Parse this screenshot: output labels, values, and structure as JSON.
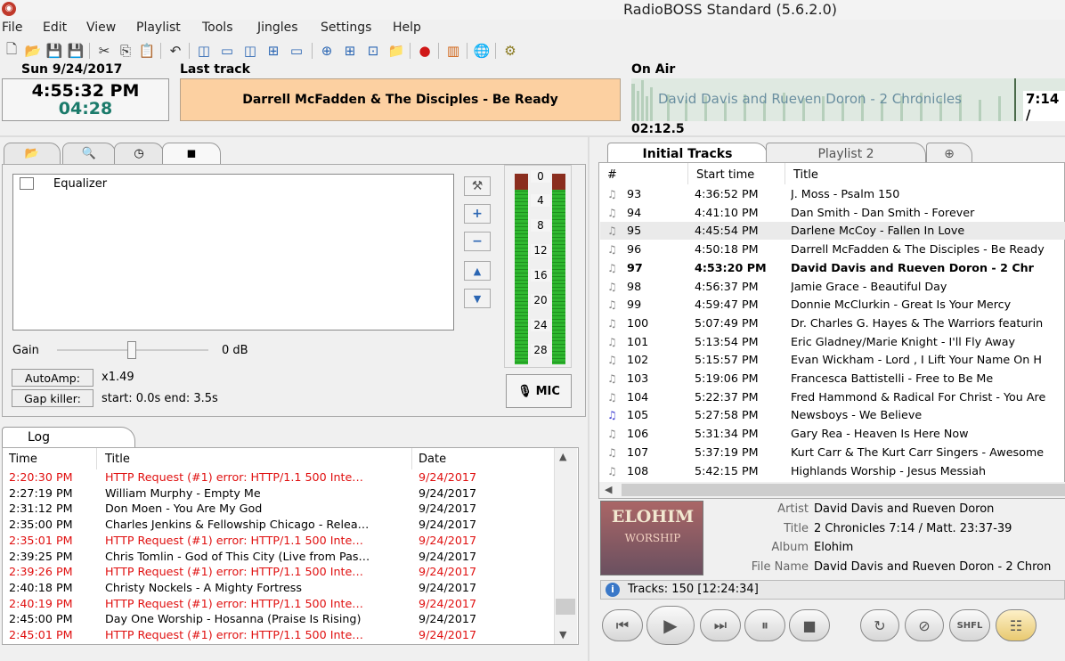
{
  "window": {
    "title": "RadioBOSS Standard (5.6.2.0)"
  },
  "menu": [
    "File",
    "Edit",
    "View",
    "Playlist",
    "Tools",
    "Jingles",
    "Settings",
    "Help"
  ],
  "header": {
    "date": "Sun 9/24/2017",
    "last_track_label": "Last track",
    "on_air_label": "On Air",
    "clock": "4:55:32 PM",
    "countdown": "04:28",
    "last_track": "Darrell McFadden & The Disciples - Be Ready",
    "on_air_title": "David Davis and Rueven Doron - 2 Chronicles",
    "on_air_time": "7:14 /",
    "elapsed": "02:12.5"
  },
  "effects": {
    "equalizer_label": "Equalizer",
    "equalizer_checked": false,
    "gain_label": "Gain",
    "gain_value": "0 dB",
    "autoamp_label": "AutoAmp:",
    "autoamp_value": "x1.49",
    "gapkiller_label": "Gap killer:",
    "gapkiller_value": "start: 0.0s end: 3.5s",
    "mic_label": "MIC",
    "vu_ticks": [
      "0",
      "4",
      "8",
      "12",
      "16",
      "20",
      "24",
      "28"
    ]
  },
  "log": {
    "tab": "Log",
    "columns": [
      "Time",
      "Title",
      "Date"
    ],
    "rows": [
      {
        "time": "2:20:30 PM",
        "title": "HTTP Request (#1) error: HTTP/1.1 500 Inte…",
        "date": "9/24/2017",
        "error": true
      },
      {
        "time": "2:27:19 PM",
        "title": "William Murphy - Empty Me",
        "date": "9/24/2017",
        "error": false
      },
      {
        "time": "2:31:12 PM",
        "title": "Don Moen - You Are My God",
        "date": "9/24/2017",
        "error": false
      },
      {
        "time": "2:35:00 PM",
        "title": "Charles Jenkins & Fellowship Chicago - Relea…",
        "date": "9/24/2017",
        "error": false
      },
      {
        "time": "2:35:01 PM",
        "title": "HTTP Request (#1) error: HTTP/1.1 500 Inte…",
        "date": "9/24/2017",
        "error": true
      },
      {
        "time": "2:39:25 PM",
        "title": "Chris Tomlin - God of This City (Live from Pas…",
        "date": "9/24/2017",
        "error": false
      },
      {
        "time": "2:39:26 PM",
        "title": "HTTP Request (#1) error: HTTP/1.1 500 Inte…",
        "date": "9/24/2017",
        "error": true
      },
      {
        "time": "2:40:18 PM",
        "title": "Christy Nockels - A Mighty Fortress",
        "date": "9/24/2017",
        "error": false
      },
      {
        "time": "2:40:19 PM",
        "title": "HTTP Request (#1) error: HTTP/1.1 500 Inte…",
        "date": "9/24/2017",
        "error": true
      },
      {
        "time": "2:45:00 PM",
        "title": "Day One Worship - Hosanna (Praise Is Rising)",
        "date": "9/24/2017",
        "error": false
      },
      {
        "time": "2:45:01 PM",
        "title": "HTTP Request (#1) error: HTTP/1.1 500 Inte…",
        "date": "9/24/2017",
        "error": true
      }
    ]
  },
  "playlist": {
    "tabs": [
      "Initial Tracks",
      "Playlist 2"
    ],
    "columns": [
      "#",
      "Start time",
      "Title"
    ],
    "rows": [
      {
        "n": "93",
        "start": "4:36:52 PM",
        "title": "J. Moss - Psalm 150"
      },
      {
        "n": "94",
        "start": "4:41:10 PM",
        "title": "Dan Smith - Dan Smith - Forever"
      },
      {
        "n": "95",
        "start": "4:45:54 PM",
        "title": "Darlene McCoy - Fallen In Love"
      },
      {
        "n": "96",
        "start": "4:50:18 PM",
        "title": "Darrell McFadden & The Disciples - Be Ready"
      },
      {
        "n": "97",
        "start": "4:53:20 PM",
        "title": "David Davis and Rueven Doron - 2 Chr"
      },
      {
        "n": "98",
        "start": "4:56:37 PM",
        "title": "Jamie Grace - Beautiful Day"
      },
      {
        "n": "99",
        "start": "4:59:47 PM",
        "title": "Donnie McClurkin - Great Is Your Mercy"
      },
      {
        "n": "100",
        "start": "5:07:49 PM",
        "title": "Dr. Charles G. Hayes & The Warriors featurin"
      },
      {
        "n": "101",
        "start": "5:13:54 PM",
        "title": "Eric Gladney/Marie Knight - I'll Fly Away"
      },
      {
        "n": "102",
        "start": "5:15:57 PM",
        "title": "Evan Wickham - Lord , I Lift Your Name On H"
      },
      {
        "n": "103",
        "start": "5:19:06 PM",
        "title": "Francesca Battistelli - Free to Be Me"
      },
      {
        "n": "104",
        "start": "5:22:37 PM",
        "title": "Fred Hammond & Radical For Christ - You Are"
      },
      {
        "n": "105",
        "start": "5:27:58 PM",
        "title": "Newsboys - We Believe"
      },
      {
        "n": "106",
        "start": "5:31:34 PM",
        "title": "Gary Rea - Heaven Is Here Now"
      },
      {
        "n": "107",
        "start": "5:37:19 PM",
        "title": "Kurt Carr & The Kurt Carr Singers - Awesome"
      },
      {
        "n": "108",
        "start": "5:42:15 PM",
        "title": "Highlands Worship - Jesus Messiah"
      }
    ],
    "current_row": "97",
    "highlight_row": "95"
  },
  "track_info": {
    "cover_title": "ELOHIM",
    "cover_subtitle": "WORSHIP",
    "artist_label": "Artist",
    "artist": "David Davis and Rueven Doron",
    "title_label": "Title",
    "title": "2 Chronicles 7:14 / Matt. 23:37-39",
    "album_label": "Album",
    "album": "Elohim",
    "filename_label": "File Name",
    "filename": "David Davis and Rueven Doron - 2 Chron"
  },
  "status": {
    "tracks": "Tracks: 150 [12:24:34]"
  },
  "player": {
    "shuffle_label": "SHFL"
  },
  "colors": {
    "error": "#e01010",
    "last_track_bg": "#fcd0a1",
    "countdown": "#1a7a6a"
  }
}
